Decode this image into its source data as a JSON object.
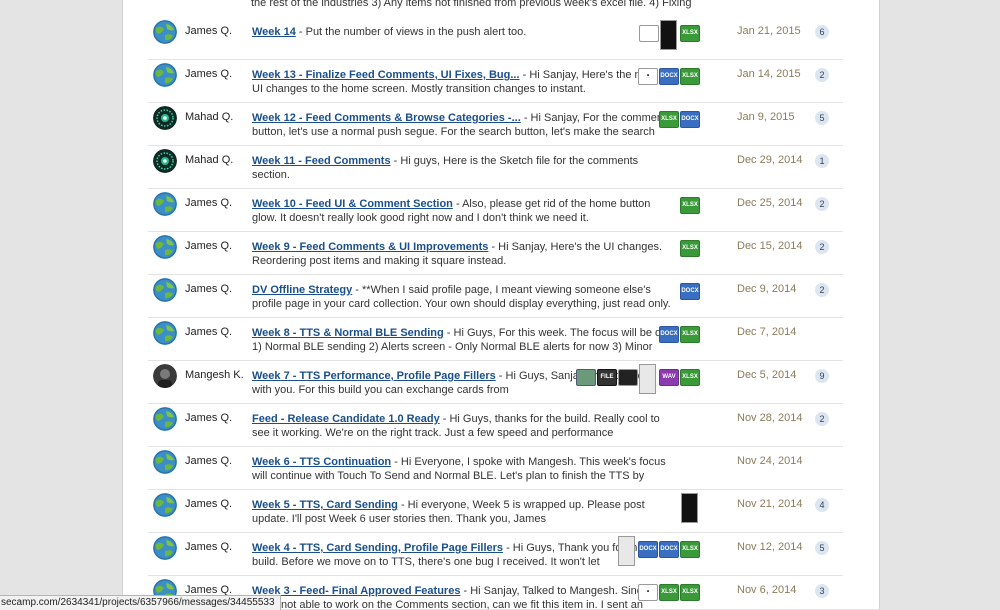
{
  "top_snippet": "the rest of the industries 3) Any items not finished from previous week's excel file. 4) Fixing",
  "rows": [
    {
      "author": "James Q.",
      "title": "Week 14",
      "snippet": " - Put the number of views in the push alert too.",
      "date": "Jan 21, 2015",
      "count": "6",
      "avatar": "globe"
    },
    {
      "author": "James Q.",
      "title": "Week 13 - Finalize Feed Comments, UI Fixes, Bug...",
      "snippet": " - Hi Sanjay, Here's the minor UI changes to the home screen. Mostly transition changes to instant.",
      "date": "Jan 14, 2015",
      "count": "2",
      "avatar": "globe"
    },
    {
      "author": "Mahad Q.",
      "title": "Week 12 - Feed Comments & Browse Categories -...",
      "snippet": " - Hi Sanjay, For the comments button, let's use a normal push segue. For the search button, let's make the search",
      "date": "Jan 9, 2015",
      "count": "5",
      "avatar": "burst"
    },
    {
      "author": "Mahad Q.",
      "title": "Week 11 - Feed Comments",
      "snippet": " - Hi guys, Here is the Sketch file for the comments section.",
      "date": "Dec 29, 2014",
      "count": "1",
      "avatar": "burst"
    },
    {
      "author": "James Q.",
      "title": "Week 10 - Feed UI & Comment Section",
      "snippet": " - Also, please get rid of the home button glow. It doesn't really look good right now and I don't think we need it.",
      "date": "Dec 25, 2014",
      "count": "2",
      "avatar": "globe"
    },
    {
      "author": "James Q.",
      "title": "Week 9 - Feed Comments & UI Improvements",
      "snippet": " - Hi Sanjay, Here's the UI changes. Reordering post items and making it square instead.",
      "date": "Dec 15, 2014",
      "count": "2",
      "avatar": "globe"
    },
    {
      "author": "James Q.",
      "title": "DV Offline Strategy",
      "snippet": " - **When I said profile page, I meant viewing someone else's profile page in your card collection. Your own should display everything, just read only.",
      "date": "Dec 9, 2014",
      "count": "2",
      "avatar": "globe"
    },
    {
      "author": "James Q.",
      "title": "Week 8 - TTS & Normal BLE Sending",
      "snippet": " - Hi Guys, For this week. The focus will be on 1) Normal BLE sending 2) Alerts screen - Only Normal BLE alerts for now 3) Minor",
      "date": "Dec 7, 2014",
      "count": "",
      "avatar": "globe"
    },
    {
      "author": "Mangesh K.",
      "title": "Week 7 - TTS Performance, Profile Page Fillers",
      "snippet": " - Hi Guys, Sanjay shared a build with you. For this build you can exchange cards from",
      "date": "Dec 5, 2014",
      "count": "9",
      "avatar": "photo"
    },
    {
      "author": "James Q.",
      "title": "Feed - Release Candidate 1.0 Ready",
      "snippet": " - Hi Guys, thanks for the build. Really cool to see it working. We're on the right track. Just a few speed and performance improvements. One",
      "date": "Nov 28, 2014",
      "count": "2",
      "avatar": "globe"
    },
    {
      "author": "James Q.",
      "title": "Week 6 - TTS Continuation",
      "snippet": " - Hi Everyone, I spoke with Mangesh. This week's focus will continue with Touch To Send and Normal BLE. Let's plan to finish the TTS by Wednesday if",
      "date": "Nov 24, 2014",
      "count": "",
      "avatar": "globe"
    },
    {
      "author": "James Q.",
      "title": "Week 5 - TTS, Card Sending",
      "snippet": " - Hi everyone, Week 5 is wrapped up. Please post update. I'll post Week 6 user stories then. Thank you, James",
      "date": "Nov 21, 2014",
      "count": "4",
      "avatar": "globe"
    },
    {
      "author": "James Q.",
      "title": "Week 4 - TTS, Card Sending, Profile Page Fillers",
      "snippet": " - Hi Guys, Thank you for the build. Before we move on to TTS, there's one bug I received. It won't let",
      "date": "Nov 12, 2014",
      "count": "5",
      "avatar": "globe"
    },
    {
      "author": "James Q.",
      "title": "Week 3 - Feed- Final Approved Features",
      "snippet": " - Hi Sanjay, Talked to Mangesh. Since we're not able to work on the Comments section, can we fit this item in. I sent an",
      "date": "Nov 6, 2014",
      "count": "3",
      "avatar": "globe"
    }
  ],
  "attachments": [
    [
      {
        "kind": "icon",
        "label": ""
      },
      {
        "kind": "phone"
      },
      {
        "kind": "xlsx",
        "label": "XLSX"
      }
    ],
    [
      {
        "kind": "icon",
        "label": "•"
      },
      {
        "kind": "docx",
        "label": "DOCX"
      },
      {
        "kind": "xlsx",
        "label": "XLSX"
      }
    ],
    [
      {
        "kind": "xlsx",
        "label": "XLSX"
      },
      {
        "kind": "docx",
        "label": "DOCX"
      }
    ],
    [],
    [
      {
        "kind": "xlsx",
        "label": "XLSX"
      }
    ],
    [
      {
        "kind": "xlsx",
        "label": "XLSX"
      }
    ],
    [
      {
        "kind": "docx",
        "label": "DOCX"
      }
    ],
    [
      {
        "kind": "docx",
        "label": "DOCX"
      },
      {
        "kind": "xlsx",
        "label": "XLSX"
      }
    ],
    [
      {
        "kind": "img",
        "label": ""
      },
      {
        "kind": "file",
        "label": "FILE"
      },
      {
        "kind": "dark",
        "label": ""
      },
      {
        "kind": "phone-light"
      },
      {
        "kind": "wav",
        "label": "WAV"
      },
      {
        "kind": "xlsx",
        "label": "XLSX"
      }
    ],
    [],
    [],
    [
      {
        "kind": "phone"
      }
    ],
    [
      {
        "kind": "phone-light"
      },
      {
        "kind": "docx",
        "label": "DOCX"
      },
      {
        "kind": "docx",
        "label": "DOCX"
      },
      {
        "kind": "xlsx",
        "label": "XLSX"
      }
    ],
    [
      {
        "kind": "icon",
        "label": "•"
      },
      {
        "kind": "xlsx",
        "label": "XLSX"
      },
      {
        "kind": "xlsx",
        "label": "XLSX"
      }
    ]
  ],
  "status_url": "secamp.com/2634341/projects/6357966/messages/34455533"
}
